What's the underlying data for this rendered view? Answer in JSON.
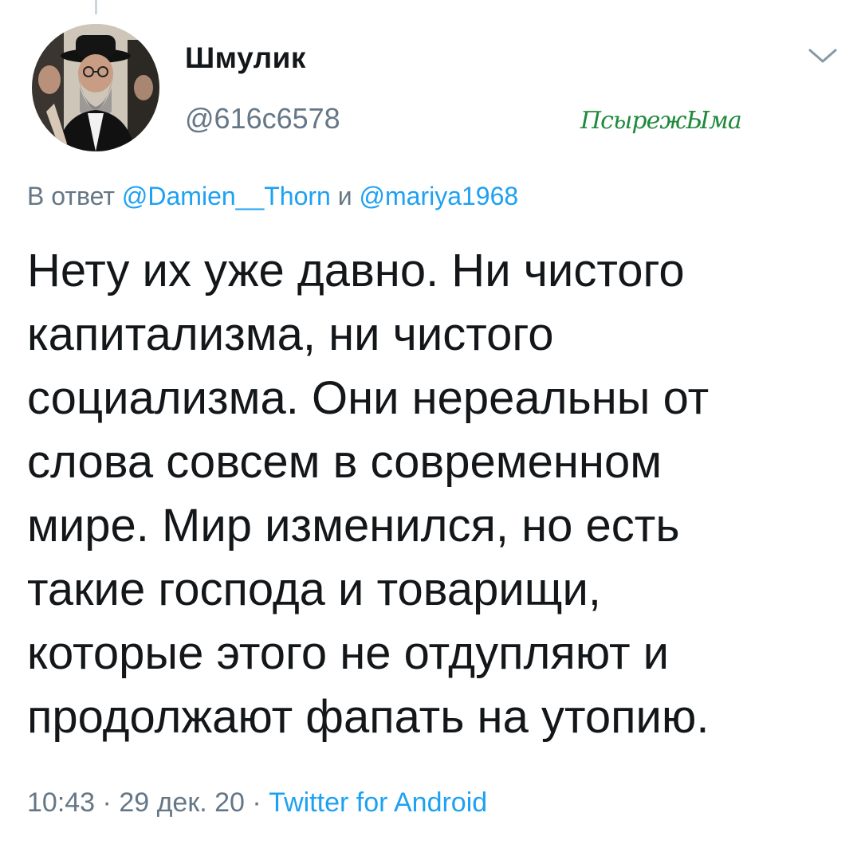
{
  "author": {
    "display_name": "Шмулик",
    "handle": "@616c6578"
  },
  "watermark": "ПсырежЫма",
  "reply_to": {
    "prefix": "В ответ",
    "mention_1": "@Damien__Thorn",
    "conjunction": "и",
    "mention_2": "@mariya1968"
  },
  "tweet": {
    "lines": [
      "Нету их уже давно. Ни чистого",
      "капитализма, ни чистого",
      "социализма. Они нереальны от",
      "слова совсем в современном",
      "мире. Мир изменился, но есть",
      "такие господа и товарищи,",
      "которые этого не отдупляют и",
      "продолжают фапать на утопию."
    ]
  },
  "meta": {
    "time": "10:43",
    "separator": "·",
    "date": "29 дек. 20",
    "source": "Twitter for Android"
  },
  "icons": {
    "menu": "chevron-down-icon"
  },
  "colors": {
    "text": "#14171a",
    "secondary": "#657786",
    "link": "#1da1f2",
    "watermark": "#1f8a3c"
  }
}
